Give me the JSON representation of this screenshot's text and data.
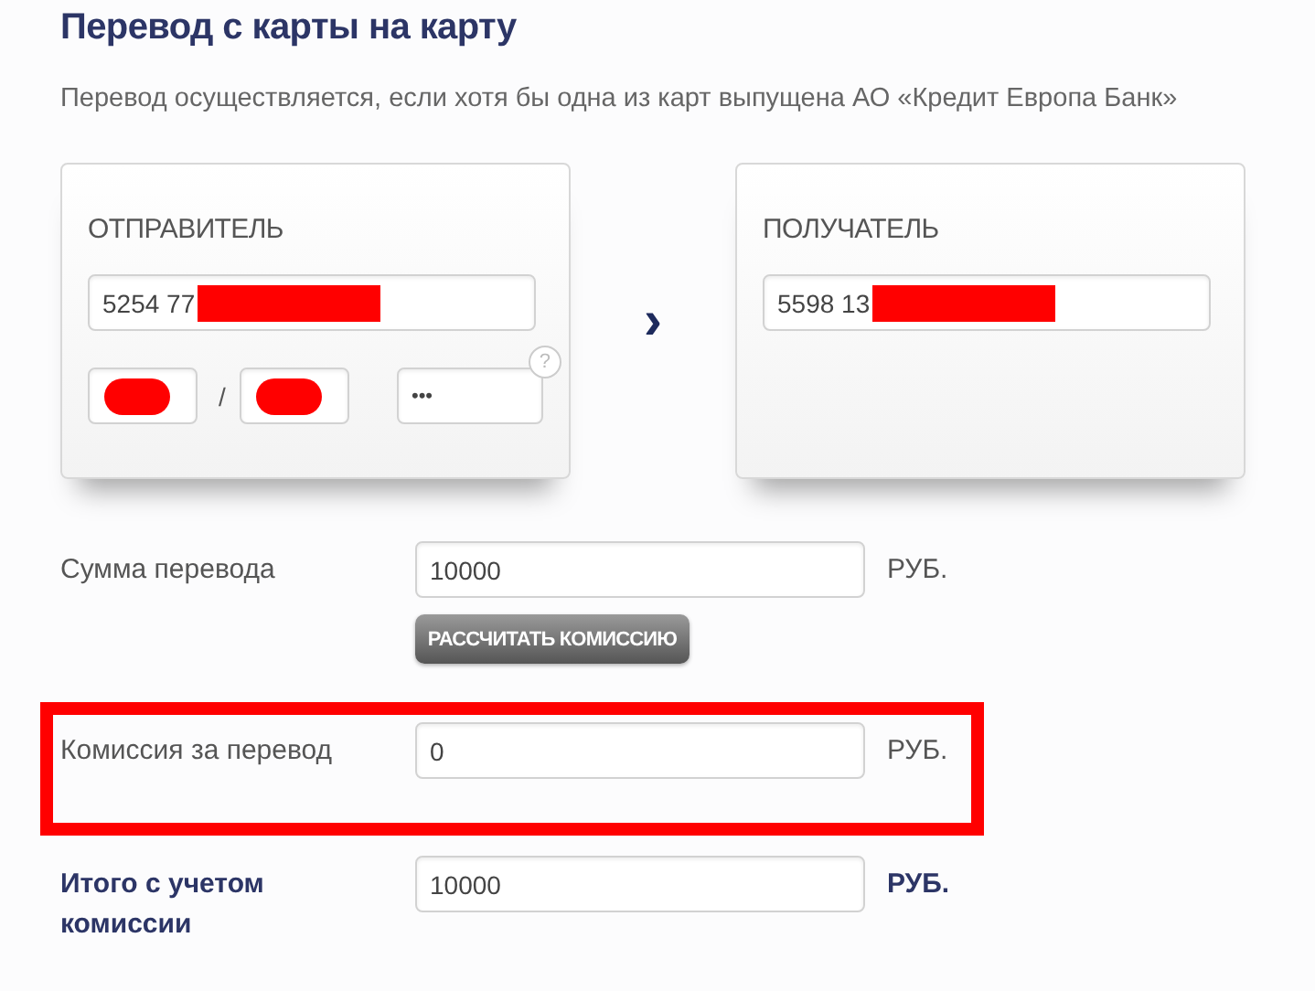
{
  "title": "Перевод с карты на карту",
  "subtitle": "Перевод осуществляется, если хотя бы одна из карт выпущена АО «Кредит Европа Банк»",
  "sender": {
    "label": "ОТПРАВИТЕЛЬ",
    "card_number": {
      "value": "5254 77",
      "redacted": true
    },
    "expiry_month": {
      "redacted": true
    },
    "slash": "/",
    "expiry_year": {
      "redacted": true
    },
    "cvv": {
      "value": "•••"
    },
    "help": "?"
  },
  "arrow": "›",
  "receiver": {
    "label": "ПОЛУЧАТЕЛЬ",
    "card_number": {
      "value": "5598 13",
      "redacted": true
    }
  },
  "rows": [
    {
      "kind": "plain",
      "label": "Сумма перевода",
      "value": "10000",
      "unit": "РУБ.",
      "highlighted": false,
      "button": "РАССЧИТАТЬ КОМИССИЮ"
    },
    {
      "kind": "plain",
      "label": "Комиссия за перевод",
      "value": "0",
      "unit": "РУБ.",
      "highlighted": true
    },
    {
      "kind": "total",
      "label": "Итого с учетом комиссии",
      "value": "10000",
      "unit": "РУБ.",
      "highlighted": false
    }
  ]
}
